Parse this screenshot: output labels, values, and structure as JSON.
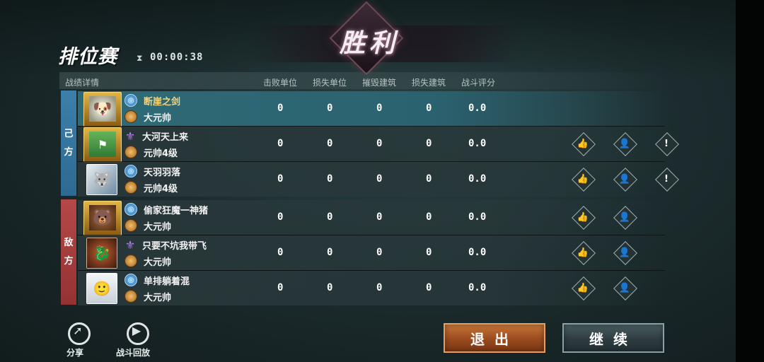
{
  "result": {
    "title": "胜利"
  },
  "header": {
    "mode": "排位赛",
    "timer": "00:00:38",
    "hourglass_icon": "hourglass-icon"
  },
  "stats": {
    "section_label": "战绩详情",
    "columns": [
      "击败单位",
      "损失单位",
      "摧毁建筑",
      "损失建筑",
      "战斗评分"
    ]
  },
  "teams": {
    "ally_label": [
      "己",
      "方"
    ],
    "enemy_label": [
      "敌",
      "方"
    ],
    "ally_color": "#3d7fab",
    "enemy_color": "#b54848"
  },
  "players": [
    {
      "team": "ally",
      "name": "断崖之剑",
      "rank": "大元帅",
      "tier_icon": "blue-tier-icon",
      "kills": "0",
      "lost_units": "0",
      "destroyed": "0",
      "lost_buildings": "0",
      "score": "0.0",
      "is_self": true,
      "actions": []
    },
    {
      "team": "ally",
      "name": "大河天上来",
      "rank": "元帅4级",
      "tier_icon": "purple-tier-icon",
      "kills": "0",
      "lost_units": "0",
      "destroyed": "0",
      "lost_buildings": "0",
      "score": "0.0",
      "is_self": false,
      "actions": [
        "like",
        "add-friend",
        "report"
      ]
    },
    {
      "team": "ally",
      "name": "天羽羽落",
      "rank": "元帅4级",
      "tier_icon": "blue-tier-icon",
      "kills": "0",
      "lost_units": "0",
      "destroyed": "0",
      "lost_buildings": "0",
      "score": "0.0",
      "is_self": false,
      "actions": [
        "like",
        "add-friend",
        "report"
      ]
    },
    {
      "team": "enemy",
      "name": "偷家狂魔一神猪",
      "rank": "大元帅",
      "tier_icon": "blue-tier-icon",
      "kills": "0",
      "lost_units": "0",
      "destroyed": "0",
      "lost_buildings": "0",
      "score": "0.0",
      "is_self": false,
      "actions": [
        "like",
        "add-friend"
      ]
    },
    {
      "team": "enemy",
      "name": "只要不坑我带飞",
      "rank": "大元帅",
      "tier_icon": "purple-tier-icon",
      "kills": "0",
      "lost_units": "0",
      "destroyed": "0",
      "lost_buildings": "0",
      "score": "0.0",
      "is_self": false,
      "actions": [
        "like",
        "add-friend"
      ]
    },
    {
      "team": "enemy",
      "name": "单排躺着混",
      "rank": "大元帅",
      "tier_icon": "blue-tier-icon",
      "kills": "0",
      "lost_units": "0",
      "destroyed": "0",
      "lost_buildings": "0",
      "score": "0.0",
      "is_self": false,
      "actions": [
        "like",
        "add-friend"
      ]
    }
  ],
  "footer": {
    "share_label": "分享",
    "replay_label": "战斗回放",
    "exit_label": "退出",
    "continue_label": "继续"
  }
}
